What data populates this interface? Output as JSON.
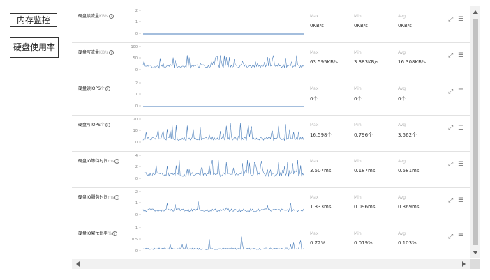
{
  "sidebar": {
    "memory_monitor_label": "内存监控",
    "disk_usage_label": "硬盘使用率"
  },
  "stat_labels": {
    "max": "Max",
    "min": "Min",
    "avg": "Avg"
  },
  "toolbar_icons": {
    "expand": "expand-icon",
    "menu": "menu-icon"
  },
  "colors": {
    "line": "#4a7ebb",
    "baseline": "#4a7ebb"
  },
  "metrics": [
    {
      "id": "disk-read-flow",
      "title": "硬盘读流量",
      "unit": "KB/s",
      "yticks": [
        "2",
        "1",
        "0"
      ],
      "ymax": 2,
      "max": "0KB/s",
      "min": "0KB/s",
      "avg": "0KB/s",
      "series": {
        "kind": "flat",
        "base": 0,
        "amp": 0,
        "spike": 0,
        "seed": 1
      }
    },
    {
      "id": "disk-write-flow",
      "title": "硬盘写流量",
      "unit": "KB/s",
      "yticks": [
        "100",
        "50",
        "0"
      ],
      "ymax": 100,
      "max": "63.595KB/s",
      "min": "3.383KB/s",
      "avg": "16.308KB/s",
      "series": {
        "kind": "spiky",
        "base": 10,
        "amp": 14,
        "spike": 45,
        "seed": 2
      }
    },
    {
      "id": "disk-read-iops",
      "title": "硬盘读IOPS",
      "unit": "个",
      "yticks": [
        "2",
        "1",
        "0"
      ],
      "ymax": 2,
      "max": "0个",
      "min": "0个",
      "avg": "0个",
      "series": {
        "kind": "flat",
        "base": 0,
        "amp": 0,
        "spike": 0,
        "seed": 3
      }
    },
    {
      "id": "disk-write-iops",
      "title": "硬盘写IOPS",
      "unit": "个",
      "yticks": [
        "20",
        "10",
        "0"
      ],
      "ymax": 20,
      "max": "16.598个",
      "min": "0.796个",
      "avg": "3.562个",
      "series": {
        "kind": "spiky",
        "base": 2,
        "amp": 3,
        "spike": 13,
        "seed": 4
      }
    },
    {
      "id": "disk-io-wait",
      "title": "硬盘IO等待时间",
      "unit": "ms",
      "yticks": [
        "4",
        "2",
        "0"
      ],
      "ymax": 4,
      "max": "3.507ms",
      "min": "0.187ms",
      "avg": "0.581ms",
      "series": {
        "kind": "spiky",
        "base": 0.4,
        "amp": 0.7,
        "spike": 2.4,
        "seed": 5
      }
    },
    {
      "id": "disk-io-service",
      "title": "硬盘IO服务时间",
      "unit": "ms",
      "yticks": [
        "2",
        "1",
        "0"
      ],
      "ymax": 2,
      "max": "1.333ms",
      "min": "0.096ms",
      "avg": "0.369ms",
      "series": {
        "kind": "noisy",
        "base": 0.3,
        "amp": 0.25,
        "spike": 0.9,
        "seed": 6
      }
    },
    {
      "id": "disk-io-busy",
      "title": "硬盘IO繁忙比率",
      "unit": "%",
      "yticks": [
        "1",
        "0.5",
        "0"
      ],
      "ymax": 1,
      "max": "0.72%",
      "min": "0.019%",
      "avg": "0.103%",
      "series": {
        "kind": "noisy",
        "base": 0.08,
        "amp": 0.07,
        "spike": 0.55,
        "seed": 7
      }
    }
  ]
}
